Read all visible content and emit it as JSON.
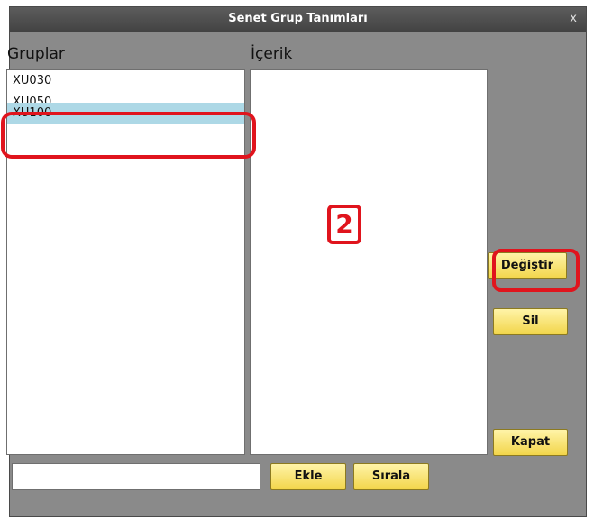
{
  "window": {
    "title": "Senet Grup Tanımları",
    "close_label": "x"
  },
  "groups": {
    "header": "Gruplar",
    "items": [
      {
        "label": "XU030"
      },
      {
        "label": "XU050"
      },
      {
        "label": "XU100"
      }
    ],
    "selected_index": 2
  },
  "content": {
    "header": "İçerik"
  },
  "buttons": {
    "change": "Değiştir",
    "delete": "Sil",
    "close": "Kapat",
    "add": "Ekle",
    "sort": "Sırala"
  },
  "new_group_input": {
    "value": "",
    "placeholder": ""
  },
  "annotation": {
    "step_number": "2",
    "highlight_color": "#e0141d"
  },
  "colors": {
    "selection": "#add8e6",
    "button_fill": "#f2d54a",
    "panel_bg": "#8a8a8a"
  }
}
